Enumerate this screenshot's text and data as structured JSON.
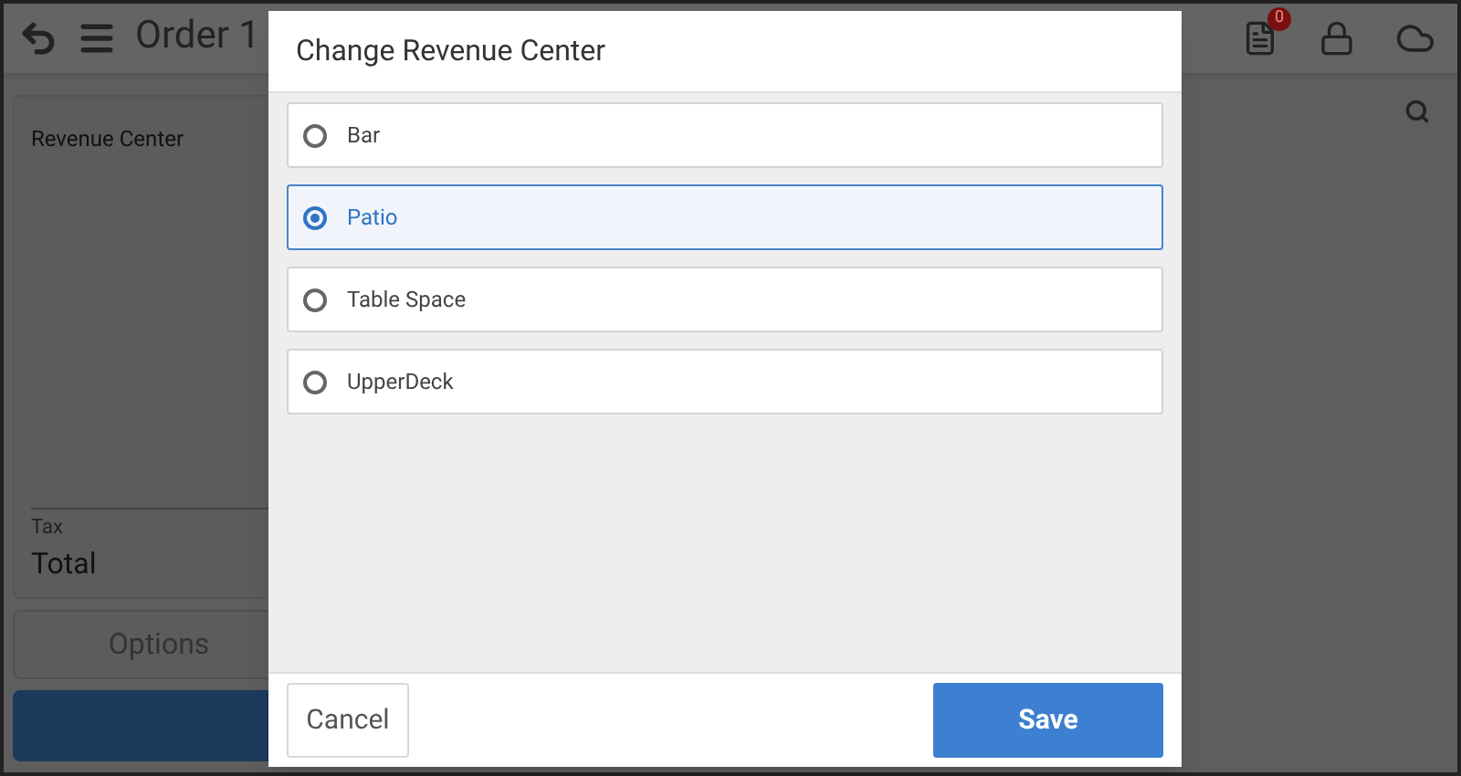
{
  "header": {
    "title": "Order 1",
    "notification_count": "0"
  },
  "summary": {
    "revenue_center_label": "Revenue Center",
    "tax_label": "Tax",
    "total_label": "Total"
  },
  "options_button": "Options",
  "dialog": {
    "title": "Change Revenue Center",
    "options": [
      {
        "label": "Bar",
        "selected": false
      },
      {
        "label": "Patio",
        "selected": true
      },
      {
        "label": "Table Space",
        "selected": false
      },
      {
        "label": "UpperDeck",
        "selected": false
      }
    ],
    "cancel_button": "Cancel",
    "save_button": "Save"
  }
}
